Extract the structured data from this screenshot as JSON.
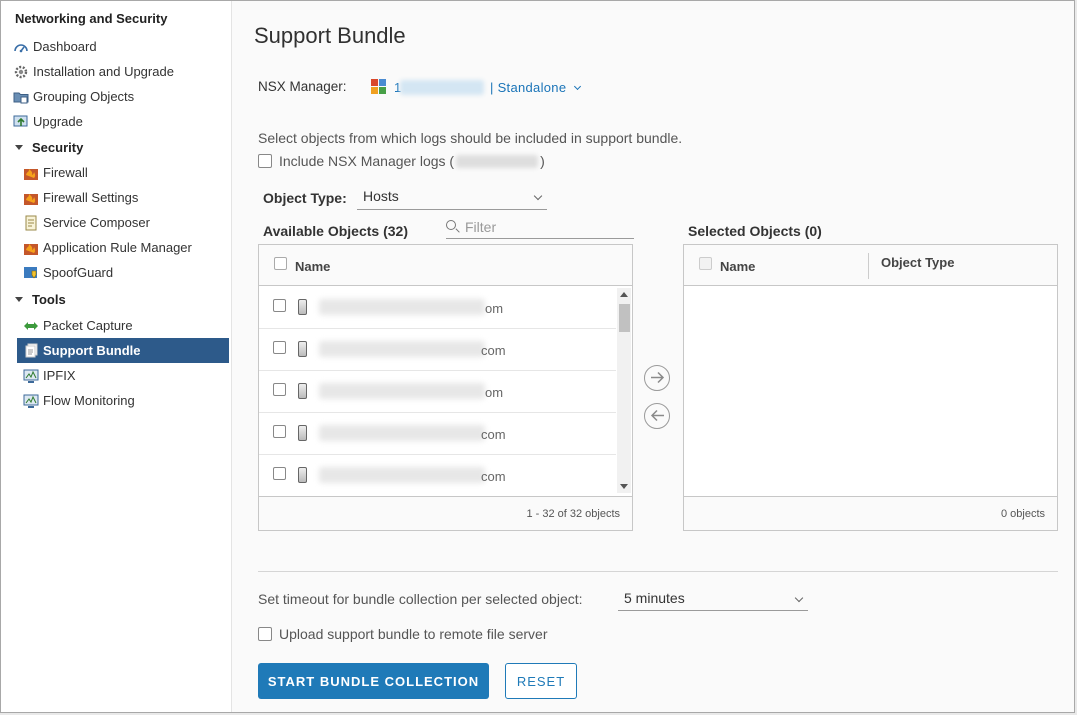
{
  "sidebar": {
    "title": "Networking and Security",
    "items": [
      {
        "label": "Dashboard",
        "icon": "dashboard-icon"
      },
      {
        "label": "Installation and Upgrade",
        "icon": "gear-icon"
      },
      {
        "label": "Grouping Objects",
        "icon": "folder-icon"
      },
      {
        "label": "Upgrade",
        "icon": "upgrade-icon"
      }
    ],
    "groups": [
      {
        "label": "Security",
        "items": [
          {
            "label": "Firewall",
            "icon": "firewall-icon"
          },
          {
            "label": "Firewall Settings",
            "icon": "firewall-icon"
          },
          {
            "label": "Service Composer",
            "icon": "document-icon"
          },
          {
            "label": "Application Rule Manager",
            "icon": "firewall-icon"
          },
          {
            "label": "SpoofGuard",
            "icon": "spoofguard-icon"
          }
        ]
      },
      {
        "label": "Tools",
        "items": [
          {
            "label": "Packet Capture",
            "icon": "packet-capture-icon"
          },
          {
            "label": "Support Bundle",
            "icon": "support-bundle-icon",
            "active": true
          },
          {
            "label": "IPFIX",
            "icon": "monitor-icon"
          },
          {
            "label": "Flow Monitoring",
            "icon": "monitor-icon"
          }
        ]
      }
    ]
  },
  "main": {
    "title": "Support Bundle",
    "manager": {
      "label": "NSX Manager:",
      "value_prefix": "1",
      "mode": "| Standalone"
    },
    "instructions": "Select objects from which logs should be included in support bundle.",
    "include_logs": {
      "label_before": "Include NSX Manager logs (",
      "label_after": ")",
      "checked": false
    },
    "object_type": {
      "label": "Object Type:",
      "value": "Hosts"
    },
    "available": {
      "title": "Available Objects (32)",
      "filter_placeholder": "Filter",
      "column": "Name",
      "rows": [
        {
          "suffix": "om"
        },
        {
          "suffix": "com"
        },
        {
          "suffix": "om"
        },
        {
          "suffix": "com"
        },
        {
          "suffix": "com"
        }
      ],
      "footer": "1 - 32 of 32 objects"
    },
    "selected": {
      "title": "Selected Objects (0)",
      "columns": [
        "Name",
        "Object Type"
      ],
      "footer": "0 objects"
    },
    "timeout": {
      "label": "Set timeout for bundle collection per selected object:",
      "value": "5 minutes"
    },
    "upload": {
      "label": "Upload support bundle to remote file server",
      "checked": false
    },
    "buttons": {
      "start": "START BUNDLE COLLECTION",
      "reset": "RESET"
    },
    "colors": {
      "accent": "#1f7ab8",
      "sidebar_active": "#2d5a8a",
      "link": "#1a74b8"
    }
  }
}
